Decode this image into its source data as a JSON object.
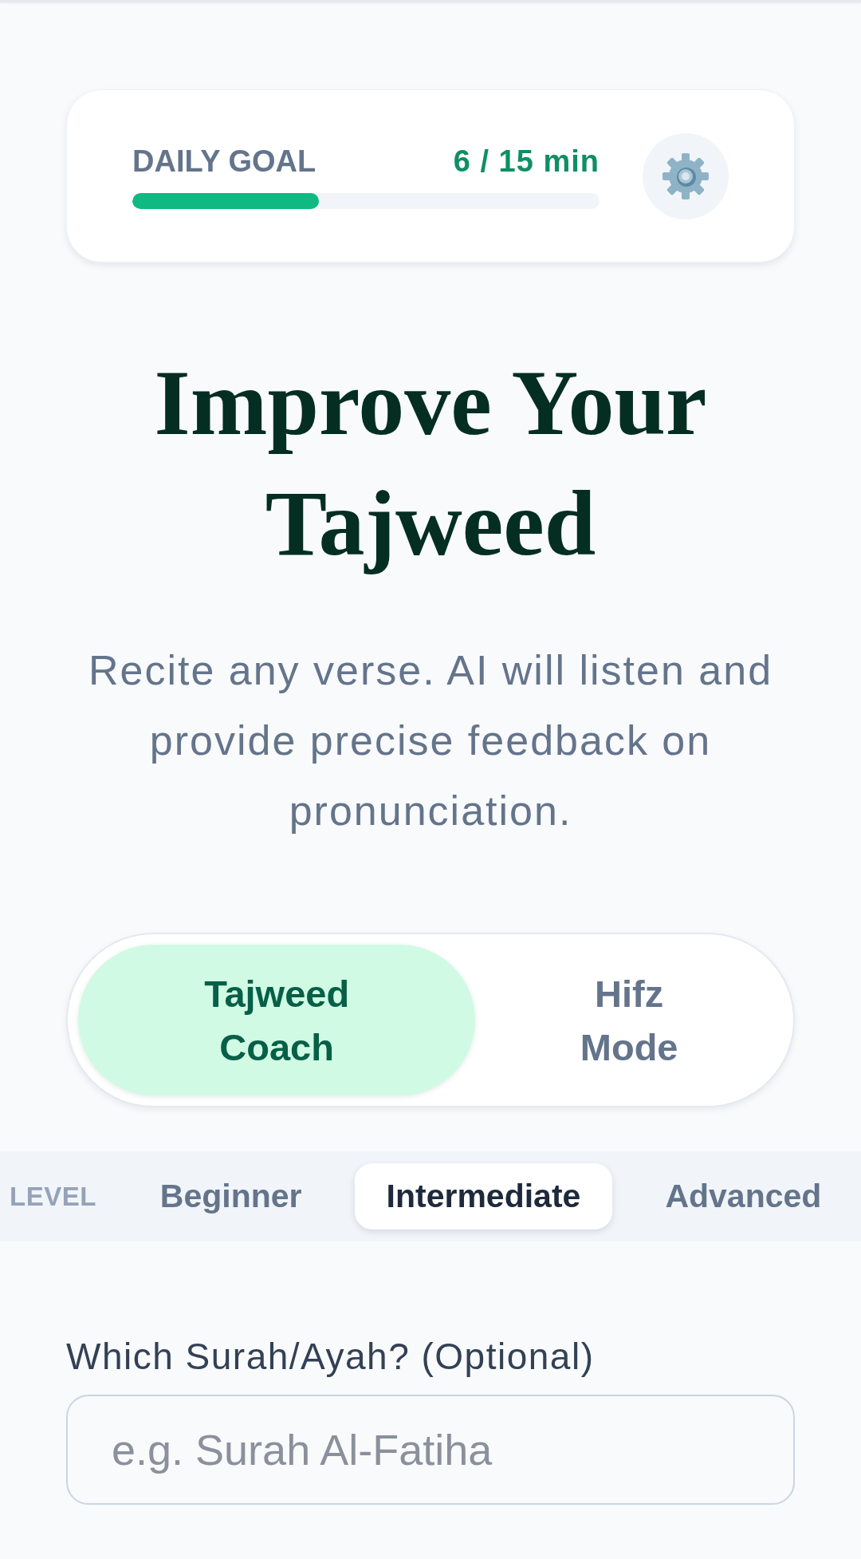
{
  "goal_card": {
    "label": "DAILY GOAL",
    "progress_text": "6 / 15 min",
    "level": 0.4
  },
  "title": "Improve Your Tajweed",
  "subtitle": "Recite any verse. AI will listen and provide precise feedback on pronunciation.",
  "mode_toggle": [
    {
      "label": "Tajweed Coach",
      "selected": true
    },
    {
      "label": "Hifz Mode",
      "selected": false
    }
  ],
  "level_selector": {
    "label": "LEVEL",
    "options": [
      {
        "label": "Beginner",
        "selected": false
      },
      {
        "label": "Intermediate",
        "selected": true
      },
      {
        "label": "Advanced",
        "selected": false
      }
    ]
  },
  "surah_field": {
    "label": "Which Surah/Ayah? (Optional)",
    "placeholder": "e.g. Surah Al-Fatiha"
  }
}
